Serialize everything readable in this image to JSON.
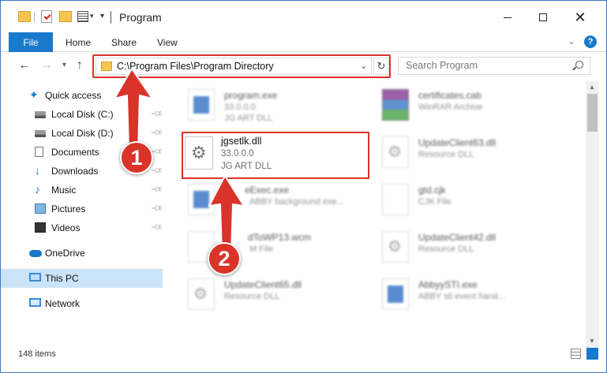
{
  "window": {
    "title": "Program",
    "controls": {
      "minimize": "minimize",
      "maximize": "maximize",
      "close": "✕"
    }
  },
  "ribbon": {
    "tabs": [
      "File",
      "Home",
      "Share",
      "View"
    ],
    "help": "?"
  },
  "navbar": {
    "address": "C:\\Program Files\\Program Directory",
    "search_placeholder": "Search Program"
  },
  "sidebar": {
    "items": [
      {
        "label": "Quick access",
        "icon": "star-icon"
      },
      {
        "label": "Local Disk (C:)",
        "icon": "drive-icon",
        "pinned": true
      },
      {
        "label": "Local Disk (D:)",
        "icon": "drive-icon",
        "pinned": true
      },
      {
        "label": "Documents",
        "icon": "documents-icon",
        "pinned": true
      },
      {
        "label": "Downloads",
        "icon": "download-icon",
        "pinned": true
      },
      {
        "label": "Music",
        "icon": "music-icon",
        "pinned": true
      },
      {
        "label": "Pictures",
        "icon": "pictures-icon",
        "pinned": true
      },
      {
        "label": "Videos",
        "icon": "videos-icon",
        "pinned": true
      },
      {
        "label": "OneDrive",
        "icon": "cloud-icon"
      },
      {
        "label": "This PC",
        "icon": "computer-icon",
        "selected": true
      },
      {
        "label": "Network",
        "icon": "network-icon"
      }
    ]
  },
  "files": [
    {
      "name": "program.exe",
      "line1": "33.0.0.0",
      "line2": "JG ART DLL"
    },
    {
      "name": "certificates.cab",
      "line1": "WinRAR Archive",
      "line2": ""
    },
    {
      "name": "UpdateClient63.dll",
      "line1": "Resource DLL",
      "line2": ""
    },
    {
      "name": "eExec.exe",
      "line1": "ABBY background exe...",
      "line2": ""
    },
    {
      "name": "gtd.cjk",
      "line1": "CJK File",
      "line2": ""
    },
    {
      "name": "dToWP13.wcm",
      "line1": "M File",
      "line2": ""
    },
    {
      "name": "UpdateClient42.dll",
      "line1": "Resource DLL",
      "line2": ""
    },
    {
      "name": "UpdateClient65.dll",
      "line1": "Resource DLL",
      "line2": ""
    },
    {
      "name": "AbbyySTI.exe",
      "line1": "ABBY sti event hand...",
      "line2": ""
    }
  ],
  "highlighted_file": {
    "name": "jgsetlk.dll",
    "line1": "33.0.0.0",
    "line2": "JG ART DLL"
  },
  "status": {
    "items_count": "148 items"
  },
  "annotations": {
    "step1": "1",
    "step2": "2"
  },
  "colors": {
    "accent": "#1979ca",
    "highlight": "#d9332a",
    "selected": "#cce4f7"
  }
}
